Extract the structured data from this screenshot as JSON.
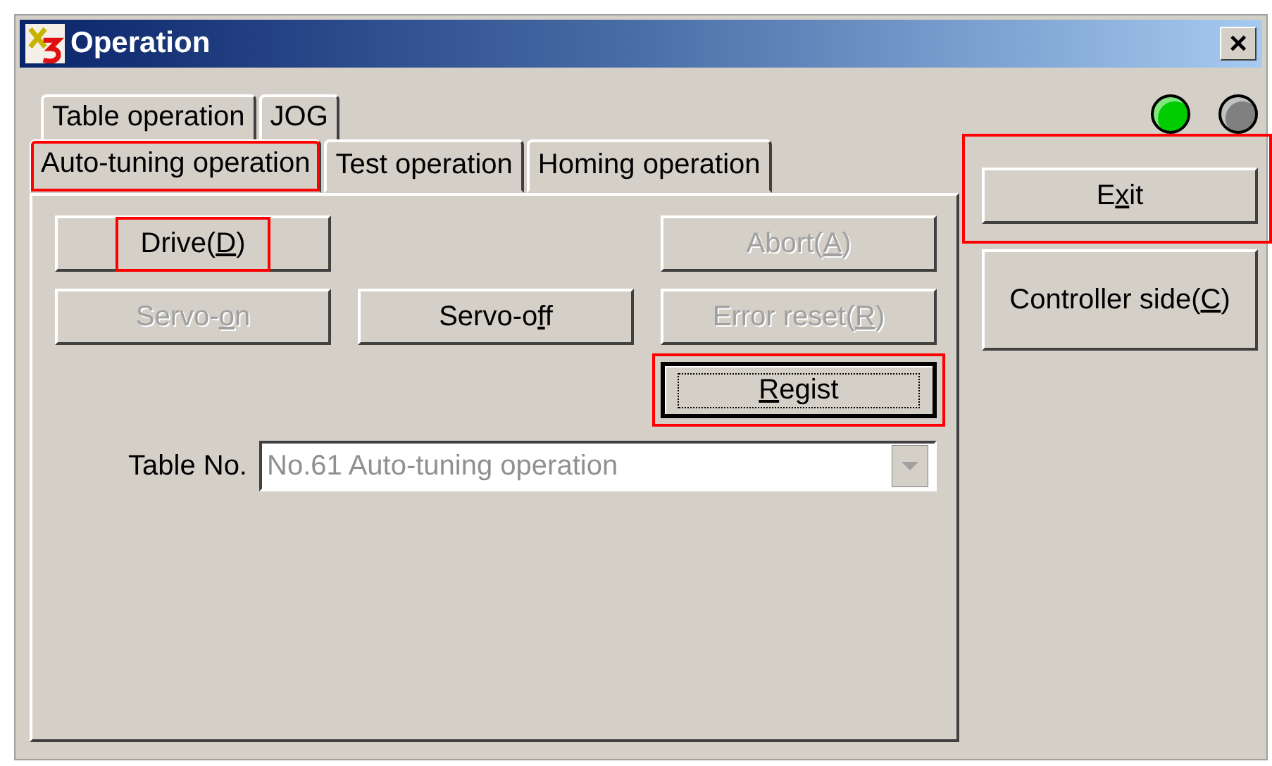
{
  "window": {
    "title": "Operation",
    "close": "×"
  },
  "tabs": [
    [
      {
        "label": "Table operation",
        "selected": false,
        "highlighted": false
      },
      {
        "label": "JOG",
        "selected": false,
        "highlighted": false
      }
    ],
    [
      {
        "label": "Auto-tuning operation",
        "selected": true,
        "highlighted": true
      },
      {
        "label": "Test operation",
        "selected": false,
        "highlighted": false
      },
      {
        "label": "Homing operation",
        "selected": false,
        "highlighted": false
      }
    ]
  ],
  "button_rows": [
    [
      {
        "kind": "button",
        "before": "Drive(",
        "key": "D",
        "after": ")",
        "disabled": false,
        "focused": false,
        "highlighted": true
      },
      {
        "kind": "gap"
      },
      {
        "kind": "button",
        "before": "Abort(",
        "key": "A",
        "after": ")",
        "disabled": true,
        "focused": false,
        "highlighted": false
      }
    ],
    [
      {
        "kind": "button",
        "before": "Servo-",
        "key": "o",
        "after": "n",
        "disabled": true,
        "focused": false,
        "highlighted": false
      },
      {
        "kind": "button",
        "before": "Servo-o",
        "key": "f",
        "after": "f",
        "disabled": false,
        "focused": false,
        "highlighted": false
      },
      {
        "kind": "button",
        "before": "Error reset(",
        "key": "R",
        "after": ")",
        "disabled": true,
        "focused": false,
        "highlighted": false
      }
    ],
    [
      {
        "kind": "gap"
      },
      {
        "kind": "gap"
      },
      {
        "kind": "button",
        "key": "R",
        "after": "egist",
        "disabled": false,
        "focused": true,
        "highlighted": true
      }
    ]
  ],
  "table_no": {
    "label": "Table No.",
    "value": "No.61 Auto-tuning operation",
    "disabled": true
  },
  "indicators": [
    {
      "color": "#00cc00"
    },
    {
      "color": "#808080"
    }
  ],
  "side_buttons": [
    {
      "before": "E",
      "key": "x",
      "after": "it",
      "highlighted": true
    },
    {
      "before": "Controller side(",
      "key": "C",
      "after": ")",
      "highlighted": false
    }
  ]
}
